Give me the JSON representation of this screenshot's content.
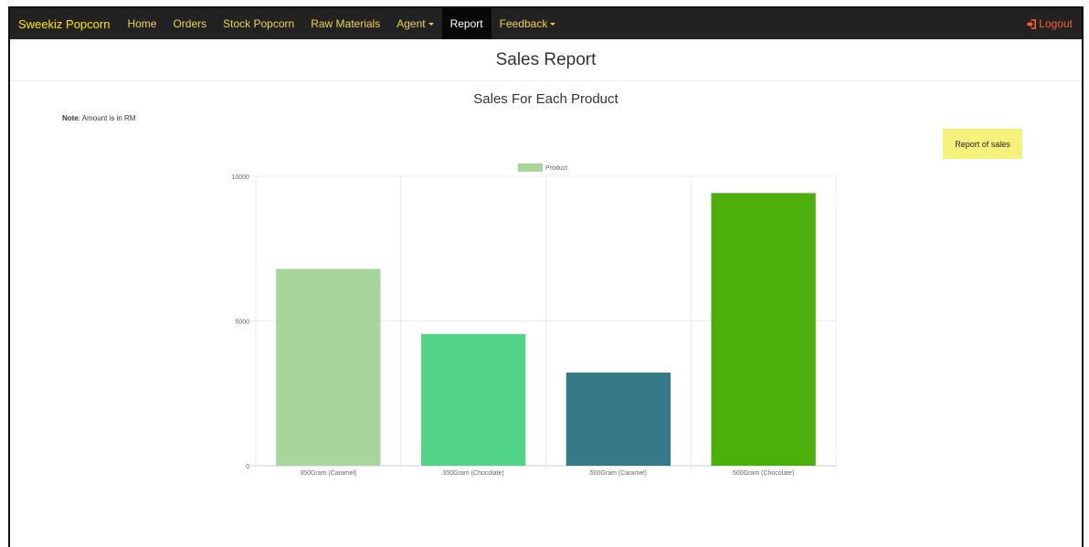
{
  "navbar": {
    "brand": "Sweekiz Popcorn",
    "items": [
      {
        "label": "Home",
        "dropdown": false,
        "active": false
      },
      {
        "label": "Orders",
        "dropdown": false,
        "active": false
      },
      {
        "label": "Stock Popcorn",
        "dropdown": false,
        "active": false
      },
      {
        "label": "Raw Materials",
        "dropdown": false,
        "active": false
      },
      {
        "label": "Agent",
        "dropdown": true,
        "active": false
      },
      {
        "label": "Report",
        "dropdown": false,
        "active": true
      },
      {
        "label": "Feedback",
        "dropdown": true,
        "active": false
      }
    ],
    "logout_label": "Logout",
    "logout_icon": "sign-out-icon"
  },
  "page": {
    "title": "Sales Report",
    "section_title": "Sales For Each Product",
    "note_label": "Note",
    "note_text": ": Amount is in RM",
    "report_button": "Report of sales"
  },
  "colors": {
    "navbar_bg": "#222222",
    "brand": "#ffe600",
    "nav_text": "#f2d24e",
    "logout": "#ff5a3c",
    "report_button_bg": "#f4f27a"
  },
  "chart_data": {
    "type": "bar",
    "title": "",
    "xlabel": "",
    "ylabel": "",
    "categories": [
      "350Gram (Caramel)",
      "350Gram (Chocolate)",
      "500Gram (Caramel)",
      "500Gram (Chocolate)"
    ],
    "series": [
      {
        "name": "Product",
        "values": [
          6800,
          4550,
          3220,
          9420
        ],
        "colors": [
          "#a8d59c",
          "#52d488",
          "#377a87",
          "#4caf0c"
        ]
      }
    ],
    "y_ticks": [
      "0",
      "5000",
      "10000"
    ],
    "ylim": [
      0,
      10000
    ],
    "grid": true,
    "legend_position": "top",
    "legend_color": "#a8d59c"
  }
}
